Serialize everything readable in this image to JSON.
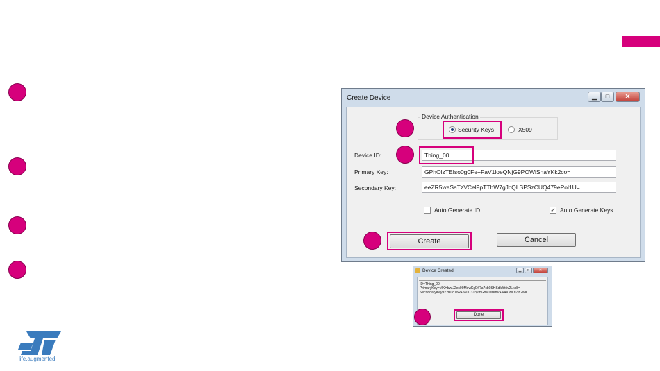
{
  "colors": {
    "accent": "#d6007c",
    "logo_blue": "#3a7bbd"
  },
  "logo": {
    "tagline": "life.augmented",
    "icon": "st-logo-icon"
  },
  "create_device": {
    "title": "Create Device",
    "group_label": "Device Authentication",
    "auth_options": [
      {
        "label": "Security Keys",
        "selected": true
      },
      {
        "label": "X509",
        "selected": false
      }
    ],
    "device_id_label": "Device ID:",
    "device_id_value": "Thing_00",
    "primary_key_label": "Primary Key:",
    "primary_key_value": "GPhOlzTEIso0g0Fe+FaV1loeQNjG9POWiShaYKk2co=",
    "secondary_key_label": "Secondary Key:",
    "secondary_key_value": "eeZR5weSaTzVCel9pTThW7gJcQLSPSzCUQ479ePol1U=",
    "auto_generate_id_label": "Auto Generate ID",
    "auto_generate_id_checked": false,
    "auto_generate_keys_label": "Auto Generate Keys",
    "auto_generate_keys_checked": true,
    "create_label": "Create",
    "cancel_label": "Cancel"
  },
  "device_created": {
    "title": "Device Created",
    "lines": [
      "ID=Thing_00",
      "PrimaryKey=MKHbwiJ2es99MewKgD/Ra7cb0SHSdkfbtfiv2Lkx8=",
      "SecondaryKey=72Buo1/W+56U7313j/mGbV1sBmV+AAX9vLd7lh2w="
    ],
    "done_label": "Done"
  }
}
